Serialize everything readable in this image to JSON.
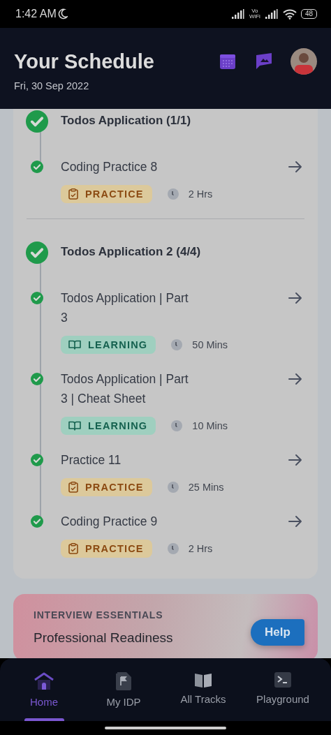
{
  "status_bar": {
    "time": "1:42 AM",
    "battery": "48",
    "network": "Vo\nWiFi"
  },
  "header": {
    "title": "Your Schedule",
    "date": "Fri, 30 Sep 2022"
  },
  "groups": [
    {
      "title": "Todos Application (1/1)",
      "completed": true,
      "items": [
        {
          "title": "Coding Practice 8",
          "completed": true,
          "kind": "practice",
          "tag": "PRACTICE",
          "duration": "2 Hrs"
        }
      ]
    },
    {
      "title": "Todos Application 2 (4/4)",
      "completed": true,
      "items": [
        {
          "title": "Todos Application | Part 3",
          "completed": true,
          "kind": "learning",
          "tag": "LEARNING",
          "duration": "50 Mins"
        },
        {
          "title": "Todos Application | Part 3 | Cheat Sheet",
          "completed": true,
          "kind": "learning",
          "tag": "LEARNING",
          "duration": "10 Mins"
        },
        {
          "title": "Practice 11",
          "completed": true,
          "kind": "practice",
          "tag": "PRACTICE",
          "duration": "25 Mins"
        },
        {
          "title": "Coding Practice 9",
          "completed": true,
          "kind": "practice",
          "tag": "PRACTICE",
          "duration": "2 Hrs"
        }
      ]
    }
  ],
  "interview_card": {
    "eyebrow": "INTERVIEW ESSENTIALS",
    "title": "Professional Readiness"
  },
  "help_button": "Help",
  "bottom_nav": [
    {
      "label": "Home",
      "kind": "home",
      "selected": true
    },
    {
      "label": "My IDP",
      "kind": "idp",
      "selected": false
    },
    {
      "label": "All Tracks",
      "kind": "tracks",
      "selected": false
    },
    {
      "label": "Playground",
      "kind": "playground",
      "selected": false
    }
  ]
}
